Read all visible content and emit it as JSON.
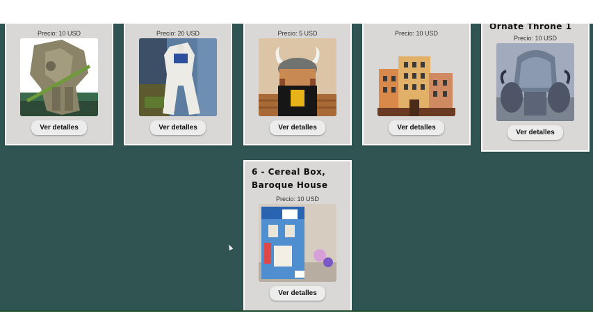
{
  "page": {
    "background": "#2f5452",
    "card_background": "#d9d8d6"
  },
  "cards": [
    {
      "title": "",
      "price": "Precio: 10 USD",
      "button": "Ver detalles",
      "image": "green-robot-figure"
    },
    {
      "title": "",
      "price": "Precio: 20 USD",
      "button": "Ver detalles",
      "image": "white-gundam-figure"
    },
    {
      "title": "",
      "price": "Precio: 5 USD",
      "button": "Ver detalles",
      "image": "viking-toy-figure"
    },
    {
      "title": "",
      "price": "Precio: 10 USD",
      "button": "Ver detalles",
      "image": "building-illustration"
    },
    {
      "title": "Ornate Throne 1",
      "price": "Precio: 10 USD",
      "button": "Ver detalles",
      "image": "ornate-throne-model"
    },
    {
      "title_line1": "6 - Cereal Box,",
      "title_line2": "Baroque House",
      "price": "Precio: 10 USD",
      "button": "Ver detalles",
      "image": "cereal-box-house"
    }
  ]
}
